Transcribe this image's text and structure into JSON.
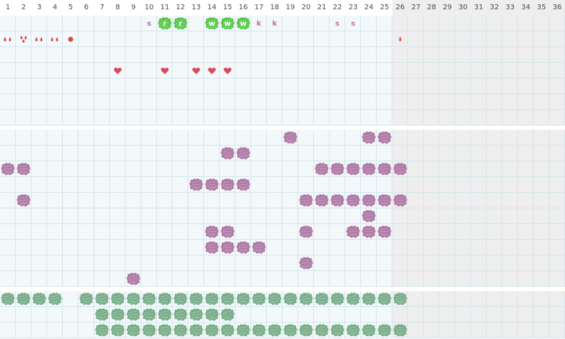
{
  "day_numbers": [
    "1",
    "2",
    "3",
    "4",
    "5",
    "6",
    "7",
    "8",
    "9",
    "10",
    "11",
    "12",
    "13",
    "14",
    "15",
    "16",
    "17",
    "18",
    "19",
    "20",
    "21",
    "22",
    "23",
    "24",
    "25",
    "26",
    "27",
    "28",
    "29",
    "30",
    "31",
    "32",
    "33",
    "34",
    "35",
    "36"
  ],
  "current_days": 25,
  "colors": {
    "grid_line": "#d3e6ec",
    "cell_bg": "#f3f8fa",
    "inactive_bg": "#eeeeee",
    "purple": "#b07aa6",
    "green": "#7aae8a",
    "bright_green": "#5ac84e",
    "red": "#d94747",
    "pink_letter": "#b0789a"
  },
  "sections": [
    {
      "name": "daily-notes",
      "rows": [
        {
          "marks": [
            {
              "day": 10,
              "type": "letter",
              "text": "s"
            },
            {
              "day": 11,
              "type": "green-letter",
              "text": "r"
            },
            {
              "day": 12,
              "type": "green-letter",
              "text": "r"
            },
            {
              "day": 14,
              "type": "green-letter",
              "text": "w"
            },
            {
              "day": 15,
              "type": "green-letter",
              "text": "w"
            },
            {
              "day": 16,
              "type": "green-letter",
              "text": "w"
            },
            {
              "day": 17,
              "type": "letter",
              "text": "k"
            },
            {
              "day": 18,
              "type": "letter",
              "text": "k"
            },
            {
              "day": 22,
              "type": "letter",
              "text": "s"
            },
            {
              "day": 23,
              "type": "letter",
              "text": "s"
            }
          ]
        },
        {
          "marks": [
            {
              "day": 1,
              "type": "drops2"
            },
            {
              "day": 2,
              "type": "drops3"
            },
            {
              "day": 3,
              "type": "drops2"
            },
            {
              "day": 4,
              "type": "drops2"
            },
            {
              "day": 5,
              "type": "dot"
            },
            {
              "day": 26,
              "type": "drop"
            }
          ]
        },
        {
          "marks": []
        },
        {
          "marks": [
            {
              "day": 8,
              "type": "heart"
            },
            {
              "day": 11,
              "type": "heart"
            },
            {
              "day": 13,
              "type": "heart"
            },
            {
              "day": 14,
              "type": "heart"
            },
            {
              "day": 15,
              "type": "heart"
            }
          ]
        },
        {
          "marks": []
        },
        {
          "marks": []
        },
        {
          "marks": []
        }
      ]
    },
    {
      "name": "purple-habits",
      "rows": [
        {
          "marks": [
            {
              "day": 19,
              "type": "purple"
            },
            {
              "day": 24,
              "type": "purple"
            },
            {
              "day": 25,
              "type": "purple"
            }
          ]
        },
        {
          "marks": [
            {
              "day": 15,
              "type": "purple"
            },
            {
              "day": 16,
              "type": "purple"
            }
          ]
        },
        {
          "marks": [
            {
              "day": 1,
              "type": "purple"
            },
            {
              "day": 2,
              "type": "purple"
            },
            {
              "day": 21,
              "type": "purple"
            },
            {
              "day": 22,
              "type": "purple"
            },
            {
              "day": 23,
              "type": "purple"
            },
            {
              "day": 24,
              "type": "purple"
            },
            {
              "day": 25,
              "type": "purple"
            },
            {
              "day": 26,
              "type": "purple"
            }
          ]
        },
        {
          "marks": [
            {
              "day": 13,
              "type": "purple"
            },
            {
              "day": 14,
              "type": "purple"
            },
            {
              "day": 15,
              "type": "purple"
            },
            {
              "day": 16,
              "type": "purple"
            }
          ]
        },
        {
          "marks": [
            {
              "day": 2,
              "type": "purple"
            },
            {
              "day": 20,
              "type": "purple"
            },
            {
              "day": 21,
              "type": "purple"
            },
            {
              "day": 22,
              "type": "purple"
            },
            {
              "day": 23,
              "type": "purple"
            },
            {
              "day": 24,
              "type": "purple"
            },
            {
              "day": 25,
              "type": "purple"
            },
            {
              "day": 26,
              "type": "purple"
            }
          ]
        },
        {
          "marks": [
            {
              "day": 24,
              "type": "purple"
            }
          ]
        },
        {
          "marks": [
            {
              "day": 14,
              "type": "purple"
            },
            {
              "day": 15,
              "type": "purple"
            },
            {
              "day": 20,
              "type": "purple"
            },
            {
              "day": 23,
              "type": "purple"
            },
            {
              "day": 24,
              "type": "purple"
            },
            {
              "day": 25,
              "type": "purple"
            }
          ]
        },
        {
          "marks": [
            {
              "day": 14,
              "type": "purple"
            },
            {
              "day": 15,
              "type": "purple"
            },
            {
              "day": 16,
              "type": "purple"
            },
            {
              "day": 17,
              "type": "purple"
            }
          ]
        },
        {
          "marks": [
            {
              "day": 20,
              "type": "purple"
            }
          ]
        },
        {
          "marks": [
            {
              "day": 9,
              "type": "purple"
            }
          ]
        }
      ]
    },
    {
      "name": "green-habits",
      "rows": [
        {
          "marks": [
            {
              "day": 1,
              "type": "green"
            },
            {
              "day": 2,
              "type": "green"
            },
            {
              "day": 3,
              "type": "green"
            },
            {
              "day": 4,
              "type": "green"
            },
            {
              "day": 6,
              "type": "green"
            },
            {
              "day": 7,
              "type": "green"
            },
            {
              "day": 8,
              "type": "green"
            },
            {
              "day": 9,
              "type": "green"
            },
            {
              "day": 10,
              "type": "green"
            },
            {
              "day": 11,
              "type": "green"
            },
            {
              "day": 12,
              "type": "green"
            },
            {
              "day": 13,
              "type": "green"
            },
            {
              "day": 14,
              "type": "green"
            },
            {
              "day": 15,
              "type": "green"
            },
            {
              "day": 16,
              "type": "green"
            },
            {
              "day": 17,
              "type": "green"
            },
            {
              "day": 18,
              "type": "green"
            },
            {
              "day": 19,
              "type": "green"
            },
            {
              "day": 20,
              "type": "green"
            },
            {
              "day": 21,
              "type": "green"
            },
            {
              "day": 22,
              "type": "green"
            },
            {
              "day": 23,
              "type": "green"
            },
            {
              "day": 24,
              "type": "green"
            },
            {
              "day": 25,
              "type": "green"
            },
            {
              "day": 26,
              "type": "green"
            }
          ]
        },
        {
          "marks": [
            {
              "day": 7,
              "type": "green"
            },
            {
              "day": 8,
              "type": "green"
            },
            {
              "day": 9,
              "type": "green"
            },
            {
              "day": 10,
              "type": "green"
            },
            {
              "day": 11,
              "type": "green"
            },
            {
              "day": 12,
              "type": "green"
            },
            {
              "day": 13,
              "type": "green"
            },
            {
              "day": 14,
              "type": "green"
            },
            {
              "day": 15,
              "type": "green"
            }
          ]
        },
        {
          "marks": [
            {
              "day": 7,
              "type": "green"
            },
            {
              "day": 8,
              "type": "green"
            },
            {
              "day": 9,
              "type": "green"
            },
            {
              "day": 10,
              "type": "green"
            },
            {
              "day": 11,
              "type": "green"
            },
            {
              "day": 12,
              "type": "green"
            },
            {
              "day": 13,
              "type": "green"
            },
            {
              "day": 14,
              "type": "green"
            },
            {
              "day": 15,
              "type": "green"
            },
            {
              "day": 16,
              "type": "green"
            },
            {
              "day": 17,
              "type": "green"
            },
            {
              "day": 18,
              "type": "green"
            },
            {
              "day": 19,
              "type": "green"
            },
            {
              "day": 20,
              "type": "green"
            },
            {
              "day": 21,
              "type": "green"
            },
            {
              "day": 22,
              "type": "green"
            },
            {
              "day": 23,
              "type": "green"
            },
            {
              "day": 24,
              "type": "green"
            },
            {
              "day": 25,
              "type": "green"
            },
            {
              "day": 26,
              "type": "green"
            }
          ]
        }
      ]
    }
  ]
}
